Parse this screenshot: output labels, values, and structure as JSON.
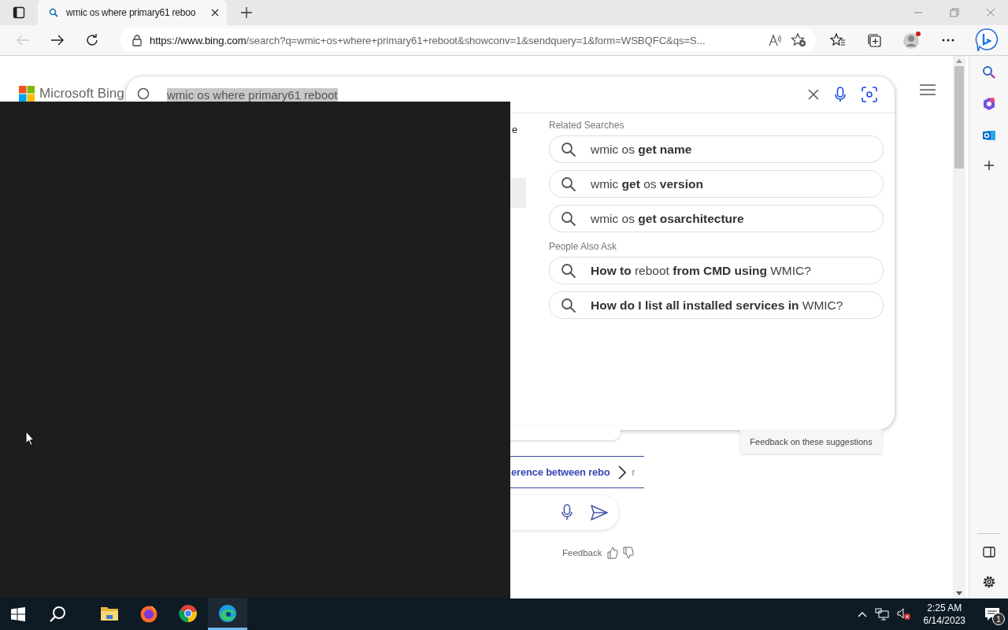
{
  "tab": {
    "title": "wmic os where primary61 reboo"
  },
  "address_bar": {
    "url_host": "https://www.bing.com",
    "url_rest": "/search?q=wmic+os+where+primary61+reboot&showconv=1&sendquery=1&form=WSBQFC&qs=S..."
  },
  "page": {
    "logo": "Microsoft Bing",
    "query": "wmic os where primary61 reboot",
    "fragment": "e",
    "sections": [
      {
        "heading": "Related Searches",
        "items": [
          "wmic os **get name**",
          "wmic **get** os **version**",
          "wmic os **get osarchitecture**"
        ]
      },
      {
        "heading": "People Also Ask",
        "items": [
          "**How to** reboot **from CMD using** WMIC?",
          "**How do I list all installed services in** WMIC?"
        ]
      }
    ],
    "feedback_suggestions": "Feedback on these suggestions",
    "link": "erence between rebo",
    "link_fragment": "r",
    "feedback": "Feedback"
  },
  "taskbar": {
    "apps": [
      {
        "kind": "files",
        "selected": false
      },
      {
        "kind": "firefox",
        "selected": false
      },
      {
        "kind": "chrome",
        "selected": false
      },
      {
        "kind": "edge",
        "selected": true
      }
    ],
    "time": "2:25 AM",
    "date": "6/14/2023",
    "notifications": "1"
  }
}
